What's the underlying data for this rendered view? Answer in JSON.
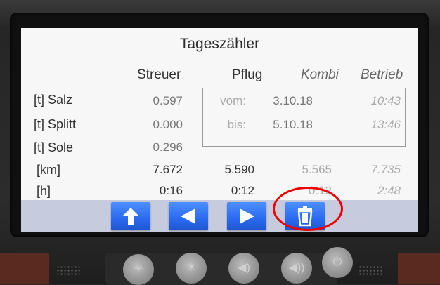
{
  "screen": {
    "title": "Tageszähler",
    "columns": [
      "Streuer",
      "Pflug",
      "Kombi",
      "Betrieb"
    ],
    "rows": [
      {
        "label": "[t] Salz",
        "streuer": "0.597"
      },
      {
        "label": "[t] Splitt",
        "streuer": "0.000"
      },
      {
        "label": "[t] Sole",
        "streuer": "0.296"
      },
      {
        "label": "[km]",
        "streuer": "7.672",
        "pflug": "5.590",
        "kombi": "5.565",
        "betrieb": "7.735"
      },
      {
        "label": "[h]",
        "streuer": "0:16",
        "pflug": "0:12",
        "kombi": "0:12",
        "betrieb": "2:48"
      }
    ],
    "date_range": {
      "from_label": "vom:",
      "from_date": "3.10.18",
      "from_time": "10:43",
      "to_label": "bis:",
      "to_date": "5.10.18",
      "to_time": "13:46"
    }
  },
  "toolbar": {
    "buttons": [
      {
        "icon": "up-arrow-icon"
      },
      {
        "icon": "left-arrow-icon"
      },
      {
        "icon": "right-arrow-icon"
      },
      {
        "icon": "trash-icon"
      }
    ]
  },
  "hardware_buttons": [
    {
      "icon": "asterisk-icon",
      "glyph": "✳"
    },
    {
      "icon": "brightness-icon",
      "glyph": "☀"
    },
    {
      "icon": "volume-down-icon",
      "glyph": "◀)"
    },
    {
      "icon": "volume-up-icon",
      "glyph": "◀))"
    },
    {
      "icon": "power-icon",
      "glyph": "⏻"
    }
  ],
  "colors": {
    "button_blue": "#2a6af0",
    "toolbar": "#c6cbdd",
    "highlight_ring": "#ee0000"
  }
}
